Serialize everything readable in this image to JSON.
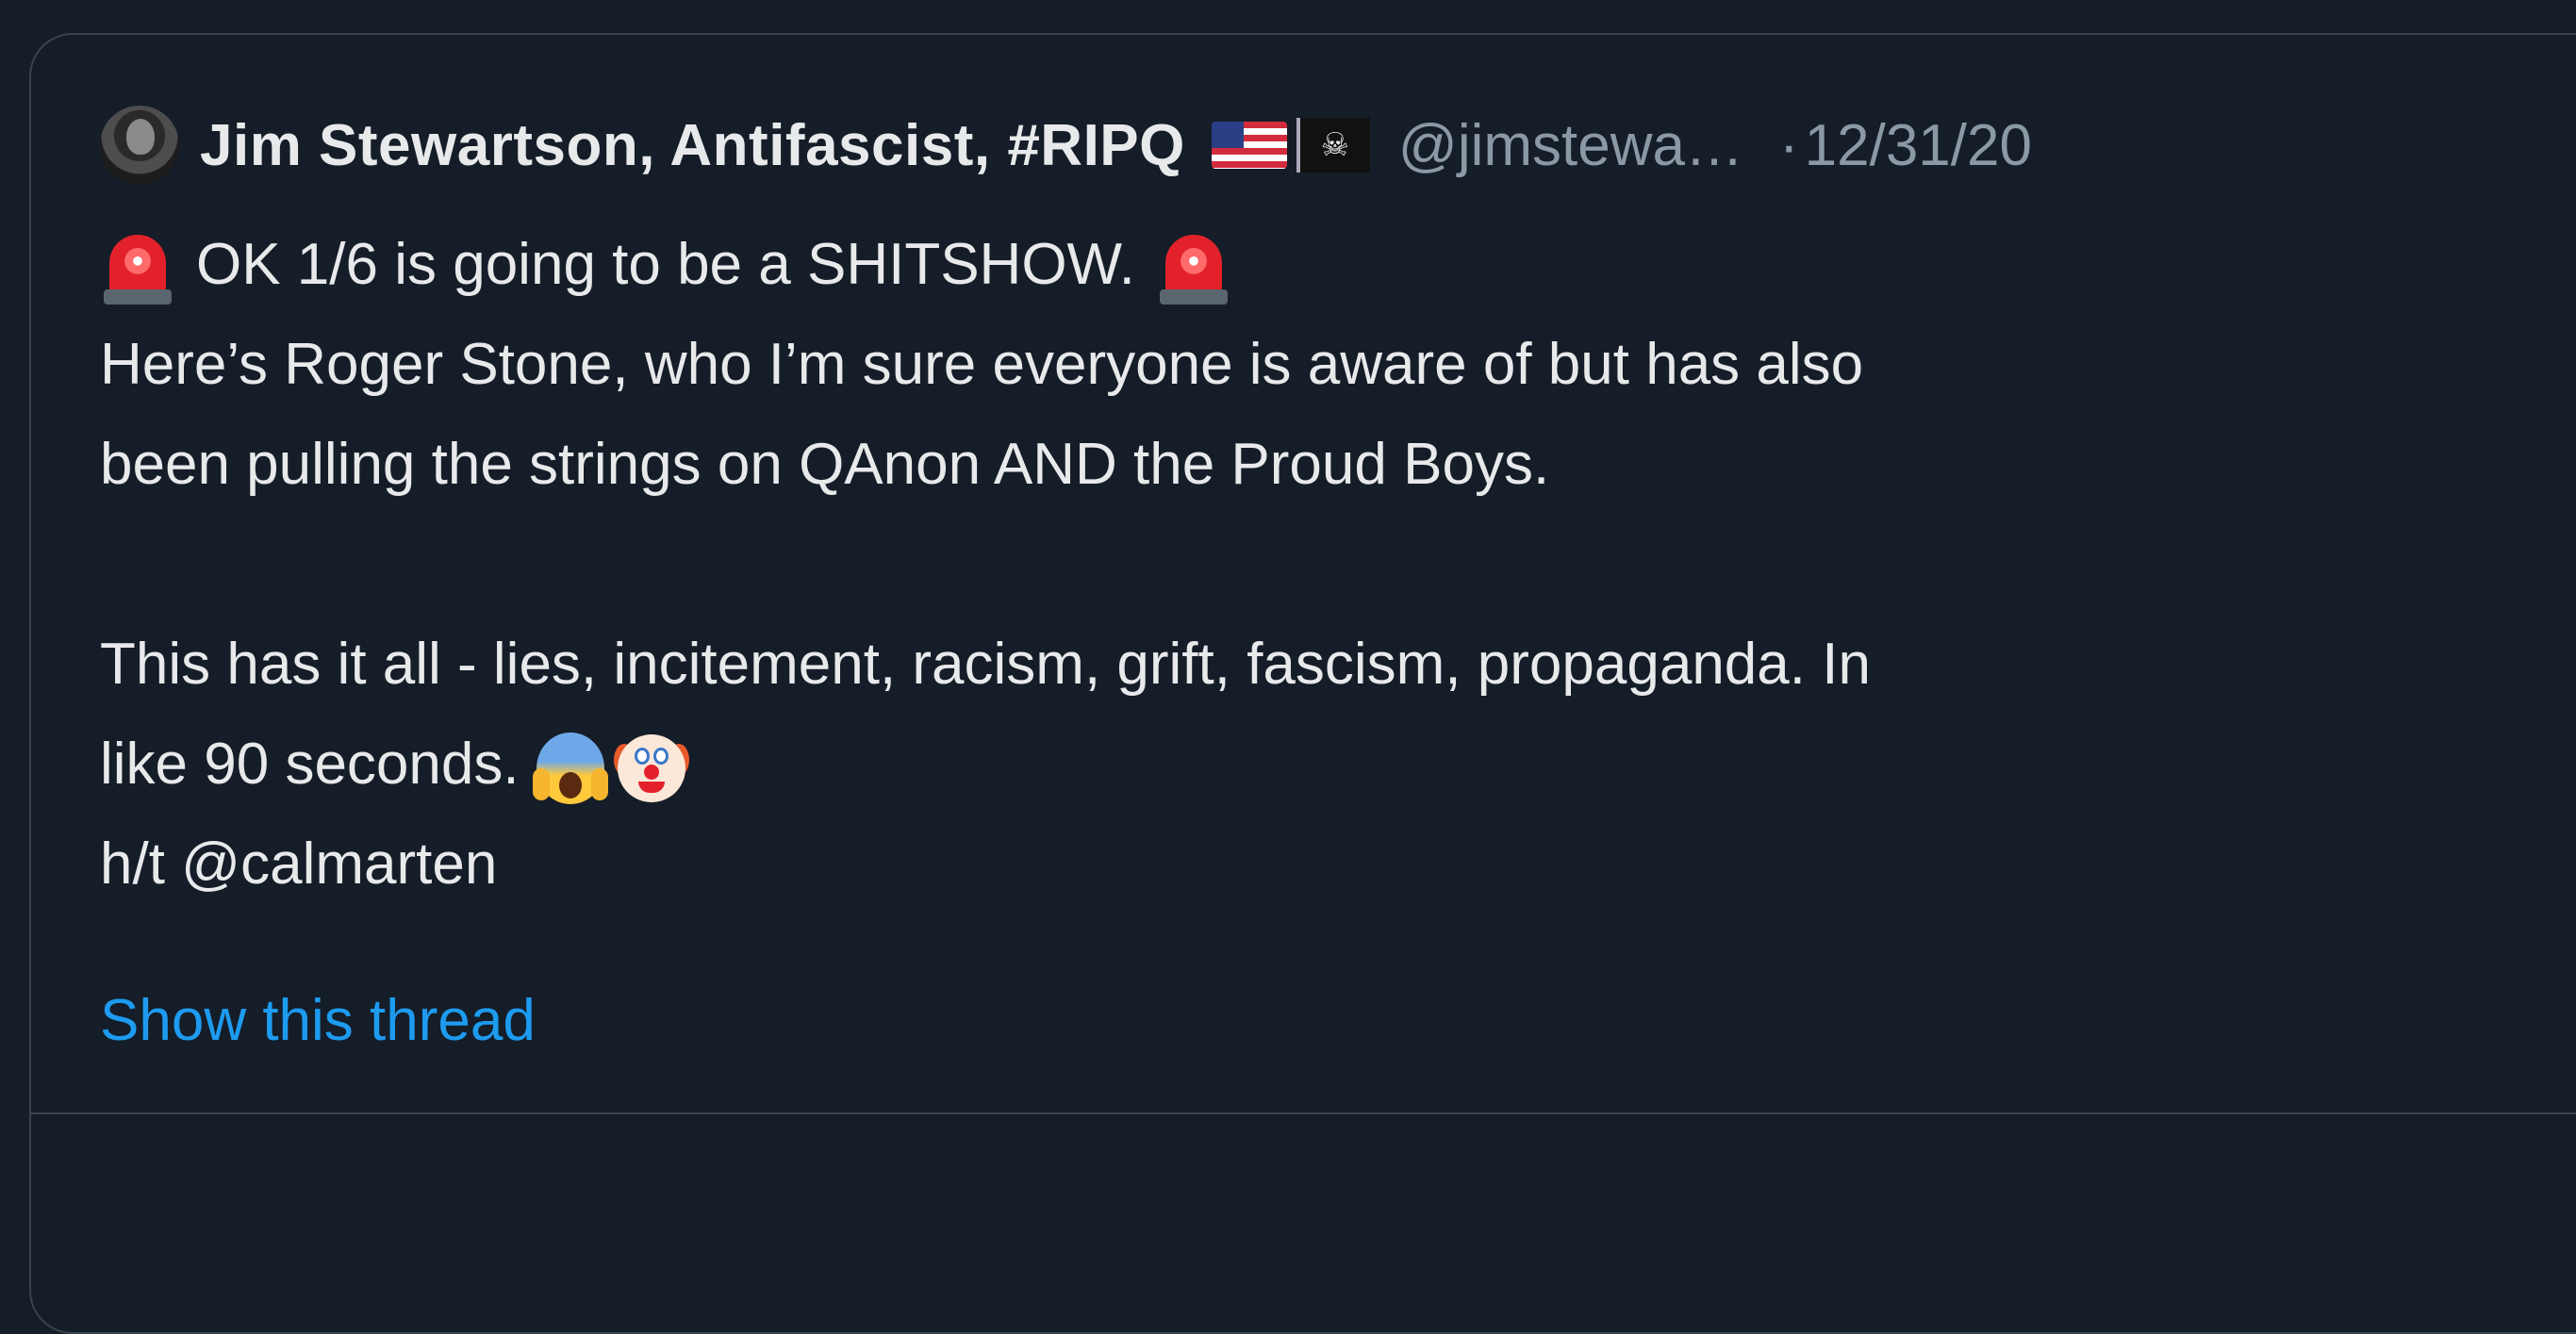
{
  "tweet": {
    "author": {
      "display_name": "Jim Stewartson, Antifascist, #RIPQ",
      "handle": "@jimstewa…",
      "badges": [
        "us-flag-emoji",
        "pirate-flag-emoji"
      ]
    },
    "separator": "·",
    "date": "12/31/20",
    "lines": [
      "OK 1/6 is going to be a SHITSHOW.",
      "Here’s Roger Stone, who I’m sure everyone is aware of but has also",
      "been pulling the strings on QAnon AND the Proud Boys.",
      "",
      "This has it all - lies, incitement, racism, grift, fascism, propaganda. In",
      "like 90 seconds.",
      "h/t @calmarten"
    ],
    "emojis": {
      "line1_prefix": "police-siren-emoji",
      "line1_suffix": "police-siren-emoji",
      "line6_suffix": [
        "face-screaming-emoji",
        "clown-face-emoji"
      ]
    },
    "show_thread_label": "Show this thread"
  },
  "colors": {
    "background": "#151d28",
    "border": "#38444d",
    "primary_text": "#e7e9ea",
    "secondary_text": "#8b98a5",
    "link": "#1d9bf0"
  }
}
